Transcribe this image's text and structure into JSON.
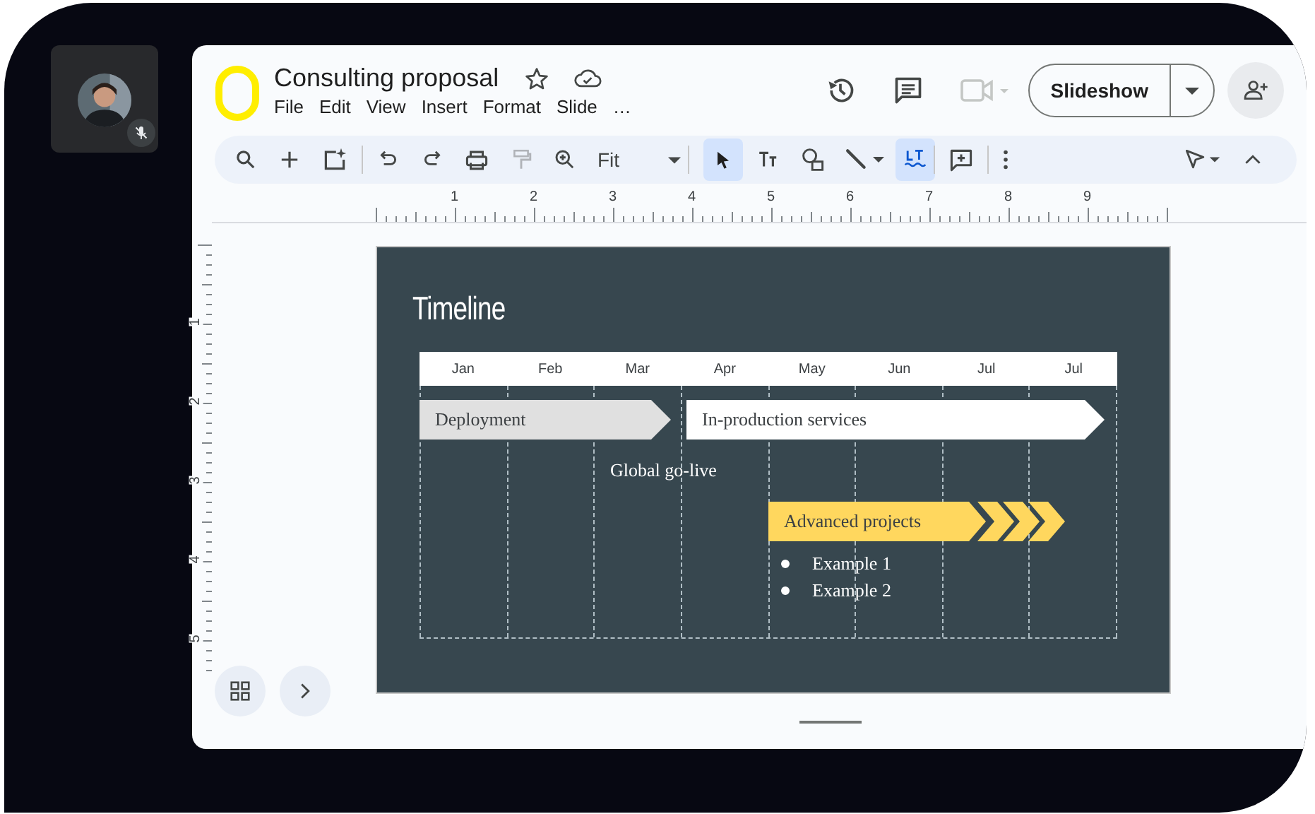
{
  "call_tile": {
    "mic_muted": true
  },
  "document": {
    "title": "Consulting proposal",
    "starred": false
  },
  "menu": [
    "File",
    "Edit",
    "View",
    "Insert",
    "Format",
    "Slide",
    "…"
  ],
  "header": {
    "camera_disabled": true,
    "slideshow": "Slideshow"
  },
  "toolbar": {
    "zoom": "Fit",
    "tools": [
      {
        "selected": true
      },
      {
        "selected": false
      },
      {
        "selected": false
      },
      {
        "selected": false
      }
    ],
    "spellcheck_on": true
  },
  "ruler": {
    "horizontal": [
      "1",
      "2",
      "3",
      "4",
      "5",
      "6",
      "7",
      "8",
      "9"
    ],
    "vertical": [
      "1",
      "2",
      "3",
      "4",
      "5"
    ]
  },
  "slide": {
    "title": "Timeline",
    "months": [
      "Jan",
      "Feb",
      "Mar",
      "Apr",
      "May",
      "Jun",
      "Jul",
      "Jul"
    ],
    "bars": [
      {
        "label": "Deployment",
        "kind": "past"
      },
      {
        "label": "In-production services",
        "kind": "ongoing"
      },
      {
        "label": "Advanced projects",
        "kind": "future"
      }
    ],
    "milestone": "Global go-live",
    "bullets": [
      "Example 1",
      "Example 2"
    ]
  }
}
